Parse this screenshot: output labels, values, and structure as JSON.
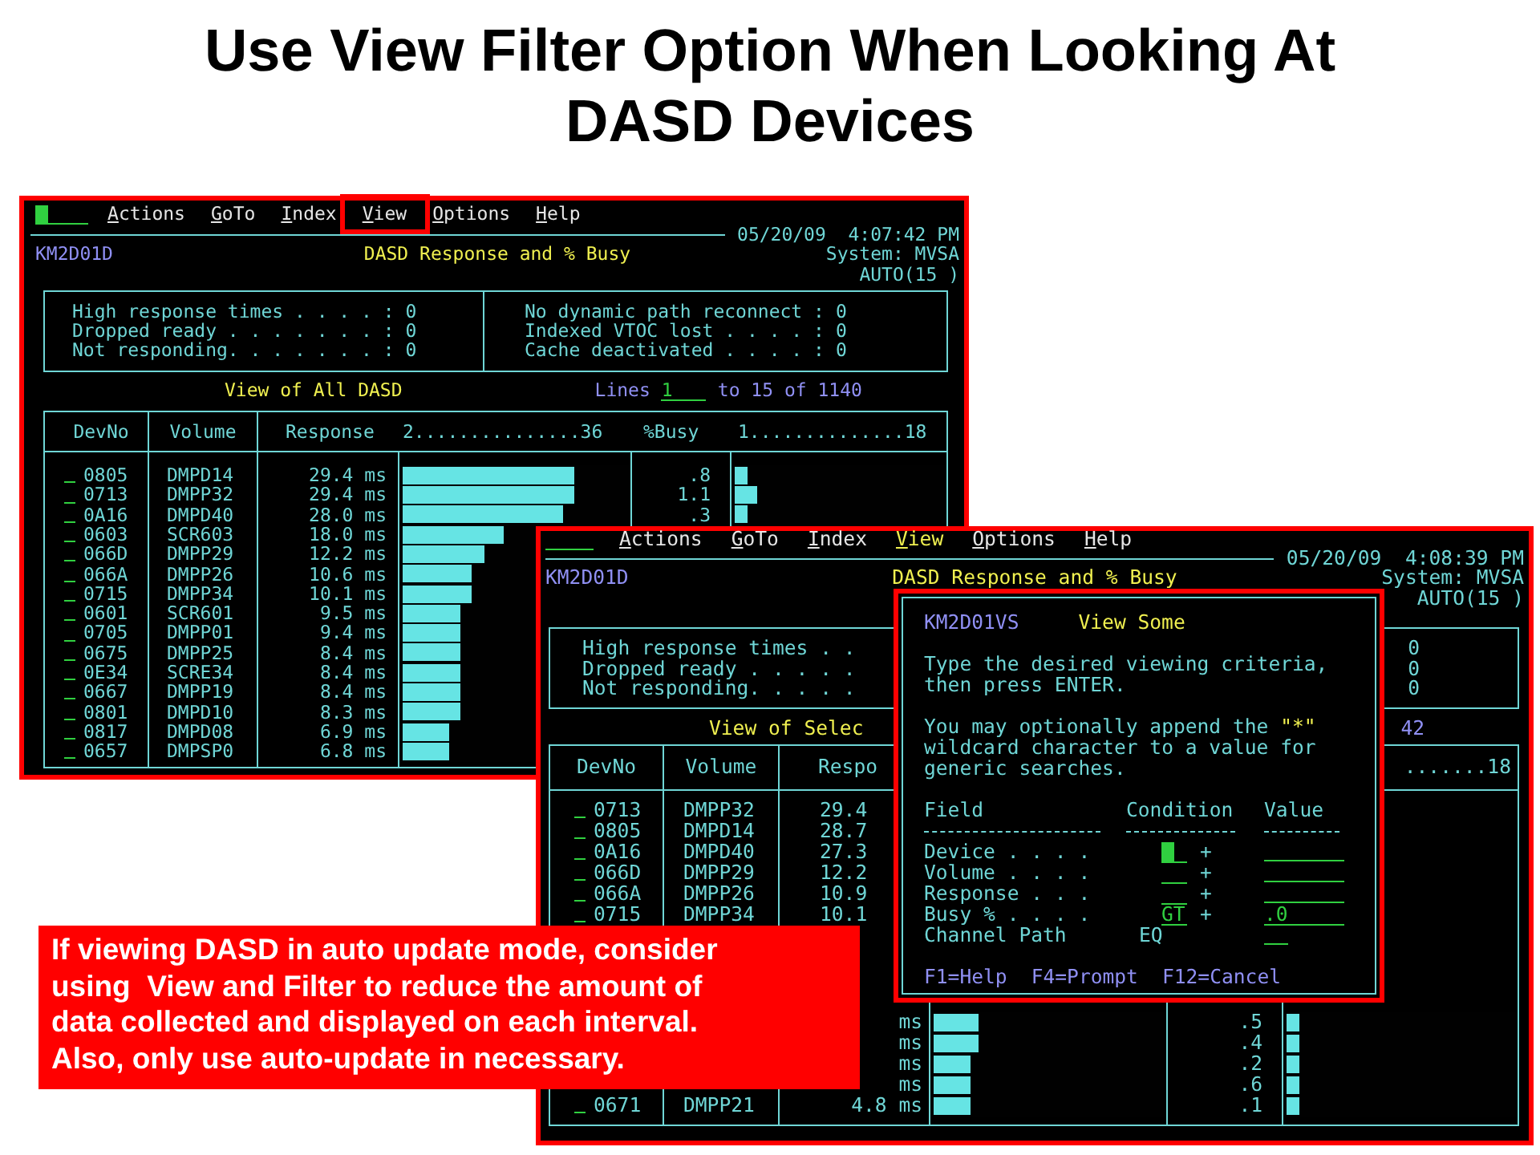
{
  "title": "Use View Filter Option When Looking At\nDASD Devices",
  "screen_all": {
    "command_cursor": true,
    "menu": [
      {
        "label": "Actions",
        "highlighted": false
      },
      {
        "label": "GoTo",
        "highlighted": false
      },
      {
        "label": "Index",
        "highlighted": false
      },
      {
        "label": "View",
        "highlighted": true
      },
      {
        "label": "Options",
        "highlighted": false
      },
      {
        "label": "Help",
        "highlighted": false
      }
    ],
    "date_time": "05/20/09  4:07:42 PM",
    "panel_id": "KM2D01D",
    "panel_title": "DASD Response and % Busy",
    "system": "System: MVSA",
    "refresh": "AUTO(15 )",
    "summary_left": [
      {
        "label": "High response times . . . . :",
        "value": "0"
      },
      {
        "label": "Dropped ready . . . . . . . :",
        "value": "0"
      },
      {
        "label": "Not responding. . . . . . . :",
        "value": "0"
      }
    ],
    "summary_right": [
      {
        "label": "No dynamic path reconnect :",
        "value": "0"
      },
      {
        "label": "Indexed VTOC lost . . . . :",
        "value": "0"
      },
      {
        "label": "Cache deactivated . . . . :",
        "value": "0"
      }
    ],
    "view_title": "View of All DASD",
    "lines": {
      "label": "Lines",
      "first": "1",
      "range": "to 15 of 1140"
    },
    "columns": {
      "devno": "DevNo",
      "volume": "Volume",
      "response": "Response",
      "response_scale": "2...............36",
      "busy": "%Busy",
      "busy_scale": "1..............18"
    },
    "rows": [
      {
        "devno": "0805",
        "volume": "DMPD14",
        "response": "29.4 ms",
        "response_bar": {
          "level": 0.77
        },
        "busy": ".8",
        "busy_bar": {
          "level": 0.06
        }
      },
      {
        "devno": "0713",
        "volume": "DMPP32",
        "response": "29.4 ms",
        "response_bar": {
          "level": 0.77
        },
        "busy": "1.1",
        "busy_bar": {
          "level": 0.11
        }
      },
      {
        "devno": "0A16",
        "volume": "DMPD40",
        "response": "28.0 ms",
        "response_bar": {
          "level": 0.72
        },
        "busy": ".3",
        "busy_bar": {
          "level": 0.06
        }
      },
      {
        "devno": "0603",
        "volume": "SCR603",
        "response": "18.0 ms",
        "response_bar": {
          "level": 0.45
        }
      },
      {
        "devno": "066D",
        "volume": "DMPP29",
        "response": "12.2 ms",
        "response_bar": {
          "level": 0.37
        }
      },
      {
        "devno": "066A",
        "volume": "DMPP26",
        "response": "10.6 ms",
        "response_bar": {
          "level": 0.31
        }
      },
      {
        "devno": "0715",
        "volume": "DMPP34",
        "response": "10.1 ms",
        "response_bar": {
          "level": 0.31
        }
      },
      {
        "devno": "0601",
        "volume": "SCR601",
        "response": "9.5 ms",
        "response_bar": {
          "level": 0.26
        }
      },
      {
        "devno": "0705",
        "volume": "DMPP01",
        "response": "9.4 ms",
        "response_bar": {
          "level": 0.26
        }
      },
      {
        "devno": "0675",
        "volume": "DMPP25",
        "response": "8.4 ms",
        "response_bar": {
          "level": 0.26
        }
      },
      {
        "devno": "0E34",
        "volume": "SCRE34",
        "response": "8.4 ms",
        "response_bar": {
          "level": 0.26
        }
      },
      {
        "devno": "0667",
        "volume": "DMPP19",
        "response": "8.4 ms",
        "response_bar": {
          "level": 0.26
        }
      },
      {
        "devno": "0801",
        "volume": "DMPD10",
        "response": "8.3 ms",
        "response_bar": {
          "level": 0.26
        }
      },
      {
        "devno": "0817",
        "volume": "DMPD08",
        "response": "6.9 ms",
        "response_bar": {
          "level": 0.21
        }
      },
      {
        "devno": "0657",
        "volume": "DMPSP0",
        "response": "6.8 ms",
        "response_bar": {
          "level": 0.21
        }
      }
    ]
  },
  "screen_filtered": {
    "command_cursor": false,
    "menu": [
      {
        "label": "Actions",
        "selected": false
      },
      {
        "label": "GoTo",
        "selected": false
      },
      {
        "label": "Index",
        "selected": false
      },
      {
        "label": "View",
        "selected": true
      },
      {
        "label": "Options",
        "selected": false
      },
      {
        "label": "Help",
        "selected": false
      }
    ],
    "date_time": "05/20/09  4:08:39 PM",
    "panel_id": "KM2D01D",
    "panel_title": "DASD Response and % Busy",
    "system": "System: MVSA",
    "refresh": "AUTO(15 )",
    "summary_left": [
      {
        "label": "High response times . ."
      },
      {
        "label": "Dropped ready . . . . ."
      },
      {
        "label": "Not responding. . . . ."
      }
    ],
    "summary_right": [
      {
        "value": "0"
      },
      {
        "value": "0"
      },
      {
        "value": "0"
      }
    ],
    "view_title": "View of Selec",
    "lines_count": "42",
    "columns": {
      "devno": "DevNo",
      "volume": "Volume",
      "response": "Respo",
      "busy_scale": ".......18"
    },
    "upper_rows": [
      {
        "devno": "0713",
        "volume": "DMPP32",
        "response": "29.4"
      },
      {
        "devno": "0805",
        "volume": "DMPD14",
        "response": "28.7"
      },
      {
        "devno": "0A16",
        "volume": "DMPD40",
        "response": "27.3"
      },
      {
        "devno": "066D",
        "volume": "DMPP29",
        "response": "12.2"
      },
      {
        "devno": "066A",
        "volume": "DMPP26",
        "response": "10.9"
      },
      {
        "devno": "0715",
        "volume": "DMPP34",
        "response": "10.1"
      }
    ],
    "lower_rows": [
      {
        "response": "ms",
        "response_bar": {
          "level": 0.2
        },
        "busy": ".5",
        "busy_bar": {
          "level": 0.05
        }
      },
      {
        "response": "ms",
        "response_bar": {
          "level": 0.2
        },
        "busy": ".4",
        "busy_bar": {
          "level": 0.05
        }
      },
      {
        "response": "ms",
        "response_bar": {
          "level": 0.16
        },
        "busy": ".2",
        "busy_bar": {
          "level": 0.05
        }
      },
      {
        "response": "ms",
        "response_bar": {
          "level": 0.16
        },
        "busy": ".6",
        "busy_bar": {
          "level": 0.05
        }
      },
      {
        "devno": "0671",
        "volume": "DMPP21",
        "response": "4.8 ms",
        "response_bar": {
          "level": 0.16
        },
        "busy": ".1",
        "busy_bar": {
          "level": 0.05
        }
      }
    ]
  },
  "dialog": {
    "panel_id": "KM2D01VS",
    "title": "View Some",
    "instructions": "Type the desired viewing criteria,\nthen press ENTER.",
    "note": [
      {
        "text": "You may optionally append the ",
        "highlight": false
      },
      {
        "text": "\"*\"",
        "highlight": true
      },
      {
        "text": "\nwildcard character to a value for\ngeneric searches.",
        "highlight": false
      }
    ],
    "headers": [
      "Field",
      "Condition",
      "Value"
    ],
    "fields": [
      {
        "kind": "entry",
        "label": "Device . . . .",
        "cursor": true,
        "prompt": "+"
      },
      {
        "kind": "entry",
        "label": "Volume . . . .",
        "cursor": false,
        "prompt": "+"
      },
      {
        "kind": "entry",
        "label": "Response . . .",
        "cursor": false,
        "prompt": "+"
      },
      {
        "kind": "entry",
        "label": "Busy % . . . .",
        "cursor": false,
        "condition": "GT",
        "prompt": "+",
        "value": ".0"
      },
      {
        "kind": "fixed",
        "label": "Channel Path",
        "condition": "EQ"
      }
    ],
    "keys": [
      "F1=Help",
      "F4=Prompt",
      "F12=Cancel"
    ]
  },
  "callout": "If viewing DASD in auto update mode, consider\nusing  View and Filter to reduce the amount of\ndata collected and displayed on each interval.\nAlso, only use auto-update in necessary."
}
